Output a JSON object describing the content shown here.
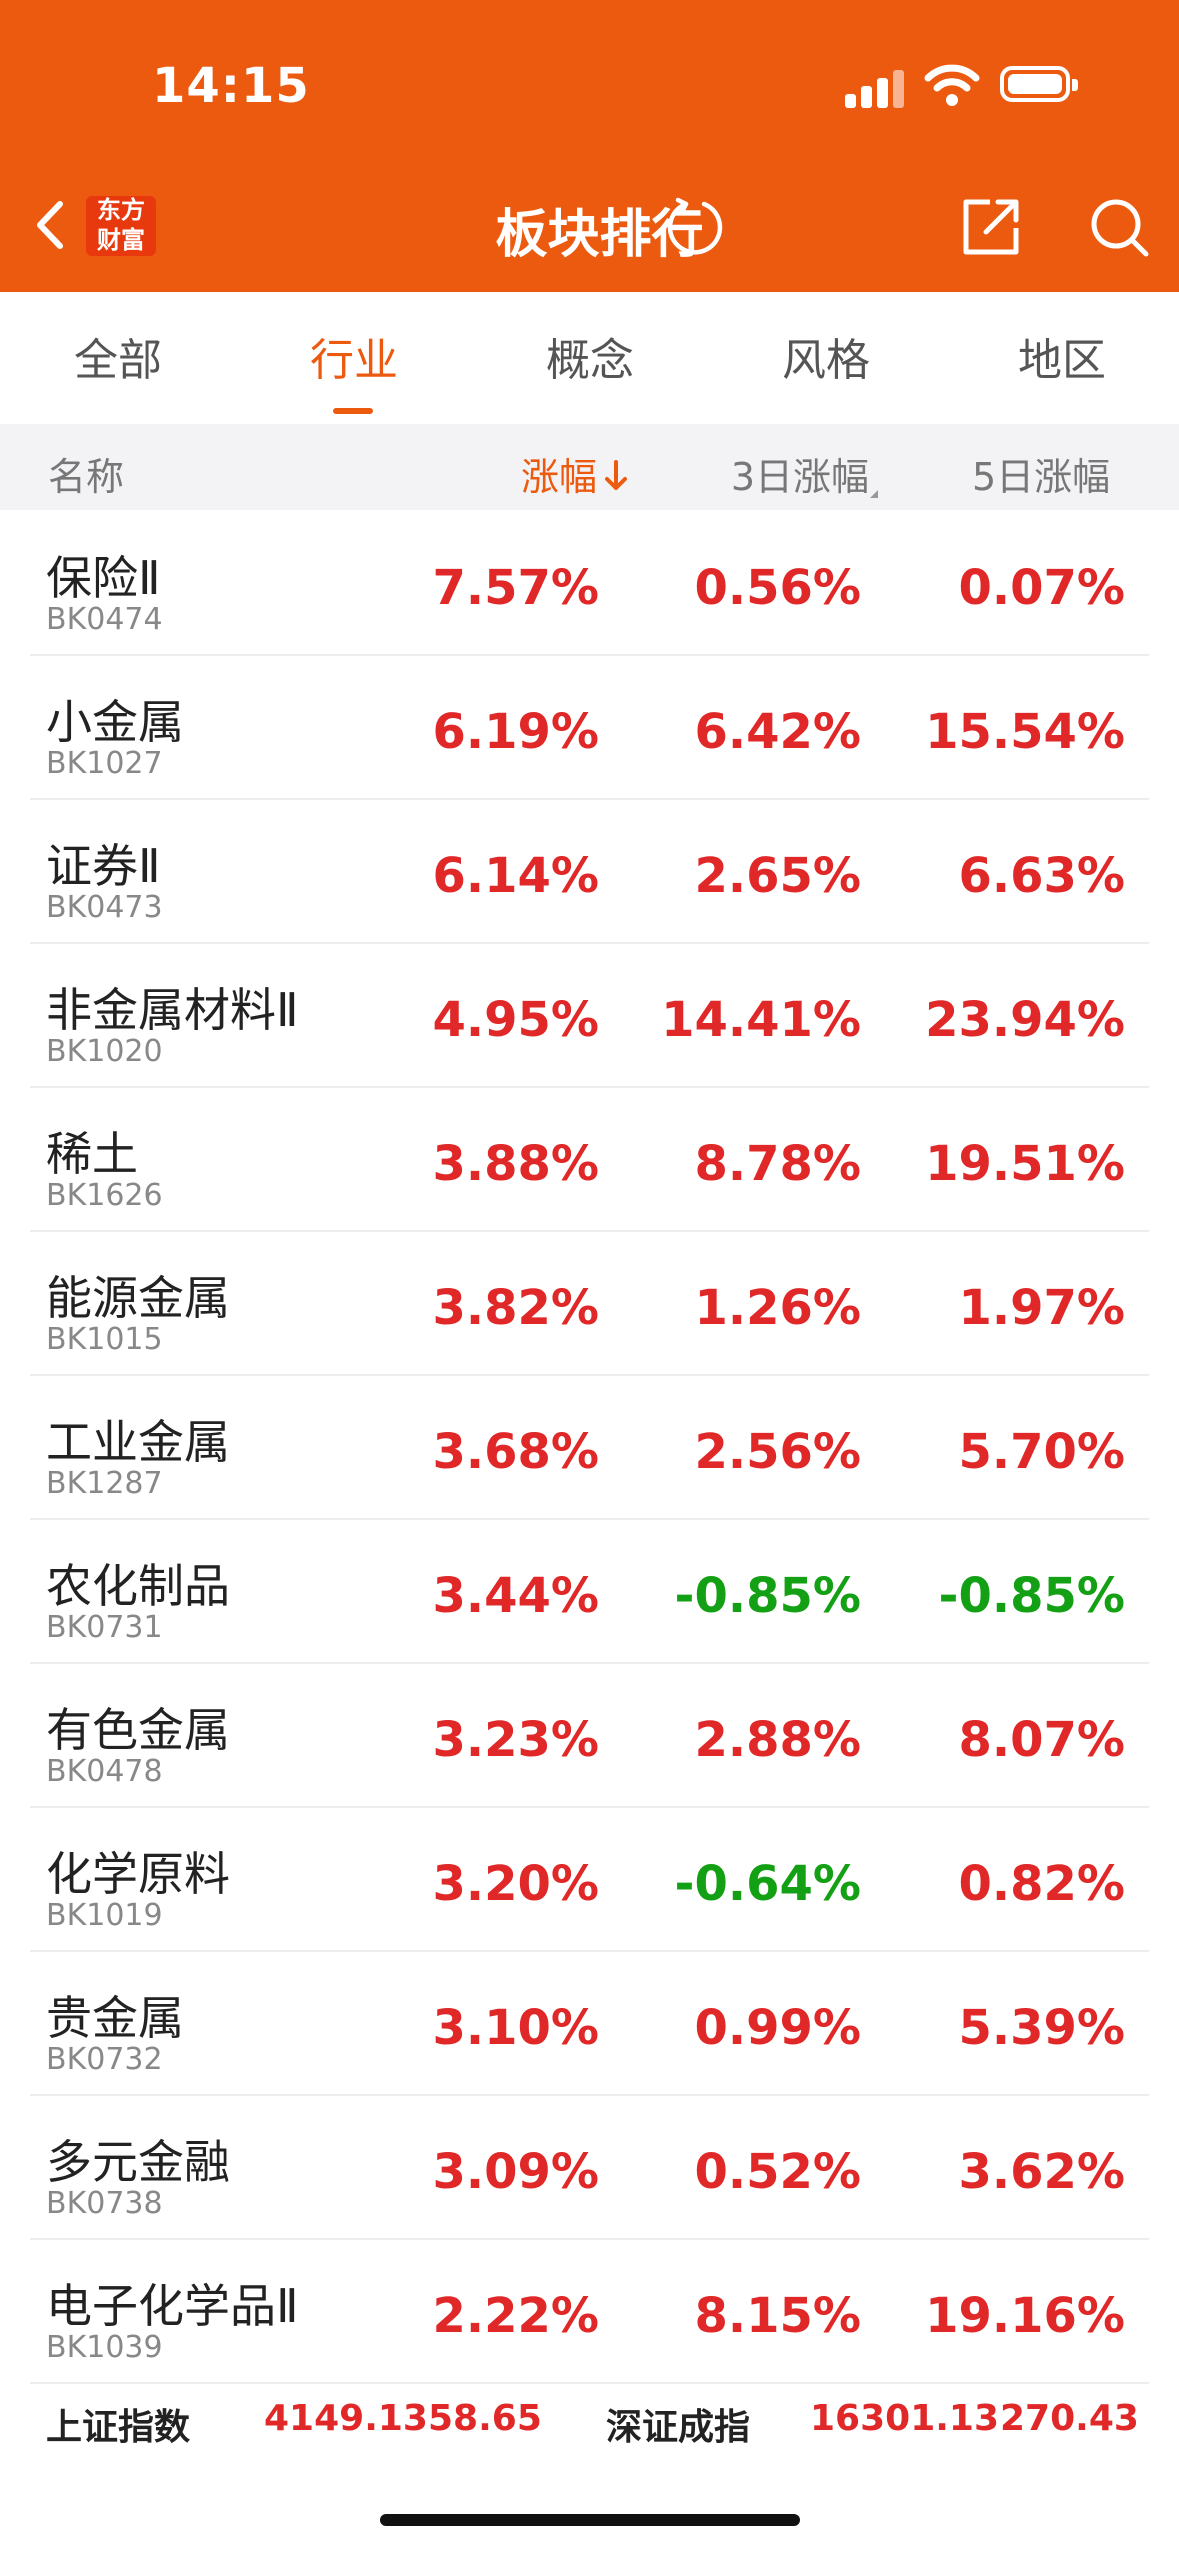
{
  "status_bar": {
    "time": "14:15"
  },
  "header": {
    "logo_line1": "东方",
    "logo_line2": "财富",
    "title": "板块排行"
  },
  "tabs": [
    {
      "label": "全部",
      "active": false
    },
    {
      "label": "行业",
      "active": true
    },
    {
      "label": "概念",
      "active": false
    },
    {
      "label": "风格",
      "active": false
    },
    {
      "label": "地区",
      "active": false
    }
  ],
  "columns": {
    "name": "名称",
    "change": "涨幅",
    "change_3d": "3日涨幅",
    "change_5d": "5日涨幅"
  },
  "rows": [
    {
      "name": "保险Ⅱ",
      "code": "BK0474",
      "change": "7.57%",
      "change_3d": "0.56%",
      "change_5d": "0.07%"
    },
    {
      "name": "小金属",
      "code": "BK1027",
      "change": "6.19%",
      "change_3d": "6.42%",
      "change_5d": "15.54%"
    },
    {
      "name": "证券Ⅱ",
      "code": "BK0473",
      "change": "6.14%",
      "change_3d": "2.65%",
      "change_5d": "6.63%"
    },
    {
      "name": "非金属材料Ⅱ",
      "code": "BK1020",
      "change": "4.95%",
      "change_3d": "14.41%",
      "change_5d": "23.94%"
    },
    {
      "name": "稀土",
      "code": "BK1626",
      "change": "3.88%",
      "change_3d": "8.78%",
      "change_5d": "19.51%"
    },
    {
      "name": "能源金属",
      "code": "BK1015",
      "change": "3.82%",
      "change_3d": "1.26%",
      "change_5d": "1.97%"
    },
    {
      "name": "工业金属",
      "code": "BK1287",
      "change": "3.68%",
      "change_3d": "2.56%",
      "change_5d": "5.70%"
    },
    {
      "name": "农化制品",
      "code": "BK0731",
      "change": "3.44%",
      "change_3d": "-0.85%",
      "change_5d": "-0.85%"
    },
    {
      "name": "有色金属",
      "code": "BK0478",
      "change": "3.23%",
      "change_3d": "2.88%",
      "change_5d": "8.07%"
    },
    {
      "name": "化学原料",
      "code": "BK1019",
      "change": "3.20%",
      "change_3d": "-0.64%",
      "change_5d": "0.82%"
    },
    {
      "name": "贵金属",
      "code": "BK0732",
      "change": "3.10%",
      "change_3d": "0.99%",
      "change_5d": "5.39%"
    },
    {
      "name": "多元金融",
      "code": "BK0738",
      "change": "3.09%",
      "change_3d": "0.52%",
      "change_5d": "3.62%"
    },
    {
      "name": "电子化学品Ⅱ",
      "code": "BK1039",
      "change": "2.22%",
      "change_3d": "8.15%",
      "change_5d": "19.16%"
    }
  ],
  "ticker": {
    "sh_name": "上证指数",
    "sh_value": "4149.13",
    "sh_change": "58.65",
    "sz_name": "深证成指",
    "sz_value": "16301.13",
    "sz_change": "270.43"
  },
  "colors": {
    "brand": "#EC5A10",
    "up": "#E02828",
    "down": "#14A014"
  }
}
